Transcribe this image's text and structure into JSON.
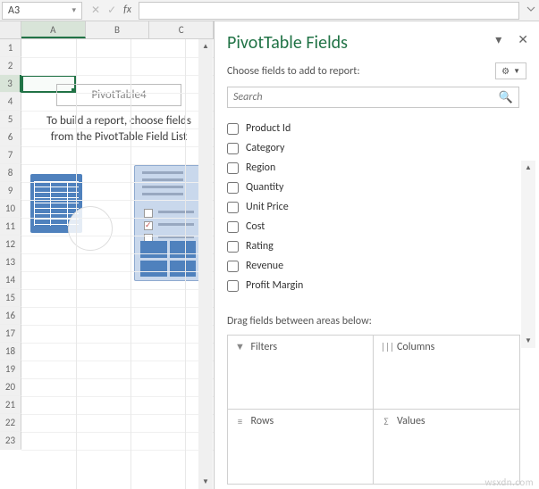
{
  "formula_bar": {
    "name_box": "A3",
    "cancel_icon": "✕",
    "confirm_icon": "✓",
    "fx_label": "fx",
    "formula": ""
  },
  "sheet": {
    "columns": [
      "A",
      "B",
      "C"
    ],
    "selected_col": "A",
    "selected_row": 3,
    "selected_cell": "A3",
    "row_count": 23
  },
  "pivot_placeholder": {
    "title": "PivotTable4",
    "message": "To build a report, choose fields from the PivotTable Field List"
  },
  "pane": {
    "title": "PivotTable Fields",
    "subtitle": "Choose fields to add to report:",
    "search_placeholder": "Search",
    "fields": [
      {
        "label": "Product Id",
        "checked": false
      },
      {
        "label": "Category",
        "checked": false
      },
      {
        "label": "Region",
        "checked": false
      },
      {
        "label": "Quantity",
        "checked": false
      },
      {
        "label": "Unit Price",
        "checked": false
      },
      {
        "label": "Cost",
        "checked": false
      },
      {
        "label": "Rating",
        "checked": false
      },
      {
        "label": "Revenue",
        "checked": false
      },
      {
        "label": "Profit Margin",
        "checked": false
      }
    ],
    "drag_label": "Drag fields between areas below:",
    "areas": {
      "filters": "Filters",
      "columns": "Columns",
      "rows": "Rows",
      "values": "Values"
    }
  },
  "watermark": "wsxdn.com"
}
